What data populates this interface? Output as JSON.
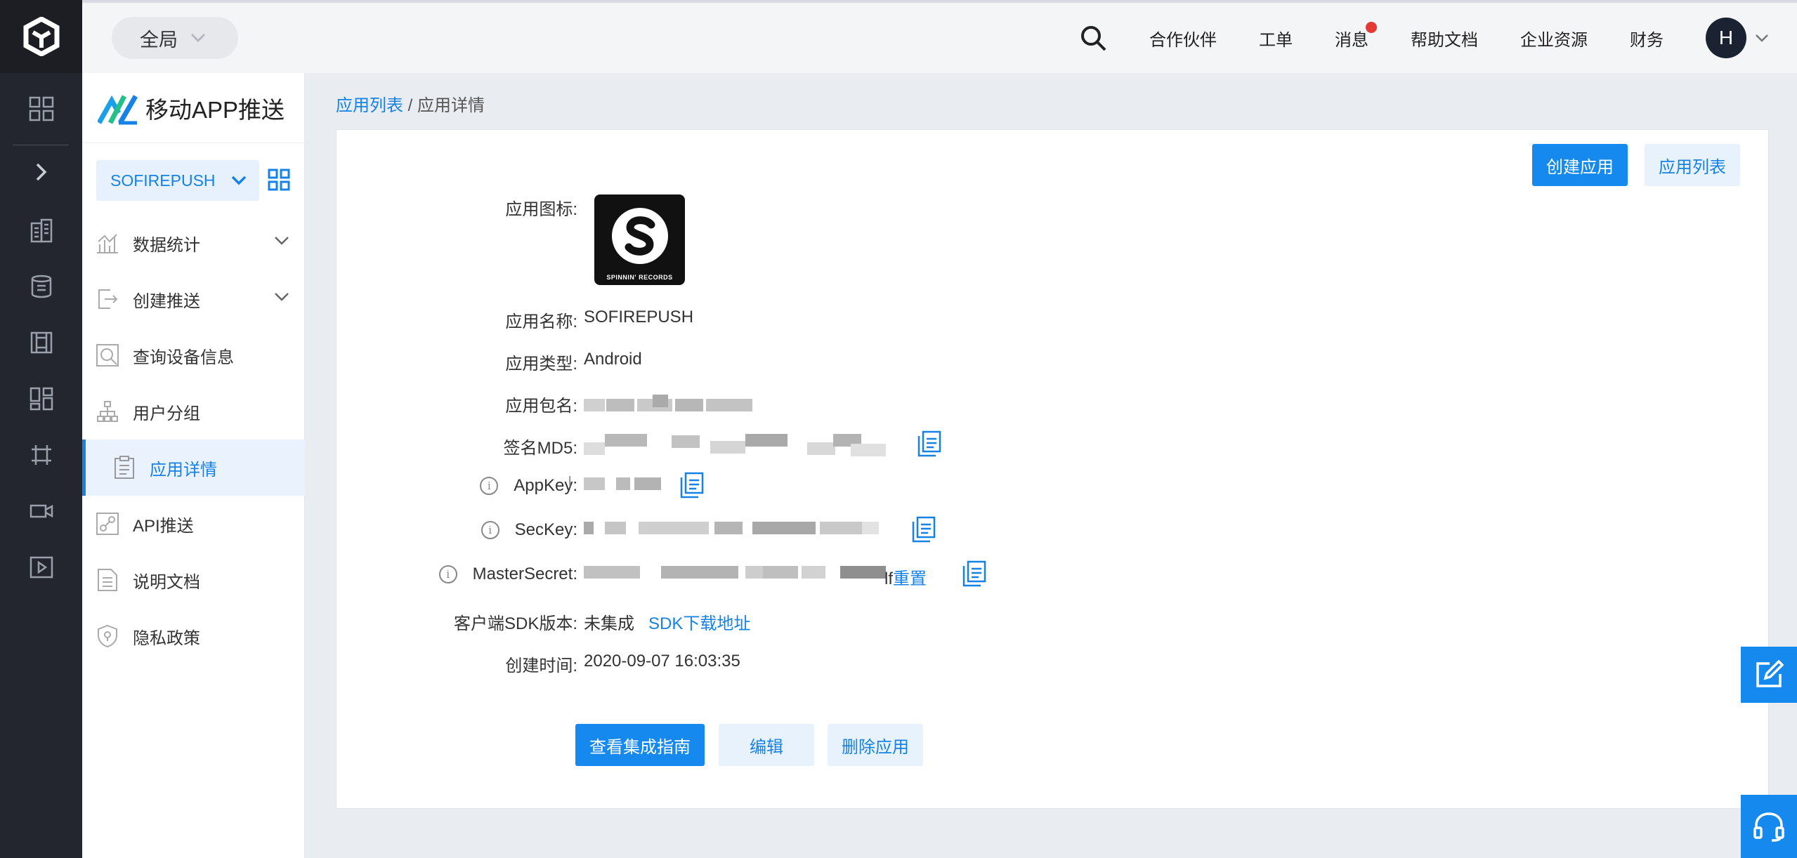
{
  "topbar": {
    "scope": "全局",
    "nav": [
      "合作伙伴",
      "工单",
      "消息",
      "帮助文档",
      "企业资源",
      "财务"
    ],
    "avatar": "H"
  },
  "sidebar": {
    "brand": "移动APP推送",
    "app_select": "SOFIREPUSH",
    "items": [
      {
        "label": "数据统计",
        "icon": "chart-icon"
      },
      {
        "label": "创建推送",
        "icon": "push-icon"
      },
      {
        "label": "查询设备信息",
        "icon": "device-search-icon"
      },
      {
        "label": "用户分组",
        "icon": "hierarchy-icon"
      },
      {
        "label": "应用详情",
        "icon": "clipboard-icon"
      },
      {
        "label": "API推送",
        "icon": "api-icon"
      },
      {
        "label": "说明文档",
        "icon": "document-icon"
      },
      {
        "label": "隐私政策",
        "icon": "shield-icon"
      }
    ]
  },
  "breadcrumb": {
    "parent": "应用列表",
    "separator": " / ",
    "current": "应用详情"
  },
  "actions": {
    "create_app": "创建应用",
    "app_list": "应用列表"
  },
  "details": {
    "icon_label": "应用图标:",
    "icon_text": "SPINNIN' RECORDS",
    "name_label": "应用名称:",
    "name": "SOFIREPUSH",
    "type_label": "应用类型:",
    "type": "Android",
    "package_label": "应用包名:",
    "md5_label": "签名MD5:",
    "appkey_label": "AppKey:",
    "appkey_tail": "l",
    "seckey_label": "SecKey:",
    "master_label": "MasterSecret:",
    "master_tail": "lf",
    "reset": "重置",
    "sdk_label": "客户端SDK版本:",
    "sdk_value": "未集成",
    "sdk_link": "SDK下载地址",
    "created_label": "创建时间:",
    "created": "2020-09-07 16:03:35"
  },
  "bottom_buttons": {
    "guide": "查看集成指南",
    "edit": "编辑",
    "delete": "删除应用"
  },
  "colors": {
    "accent": "#1589ee",
    "rail": "#23262e"
  }
}
